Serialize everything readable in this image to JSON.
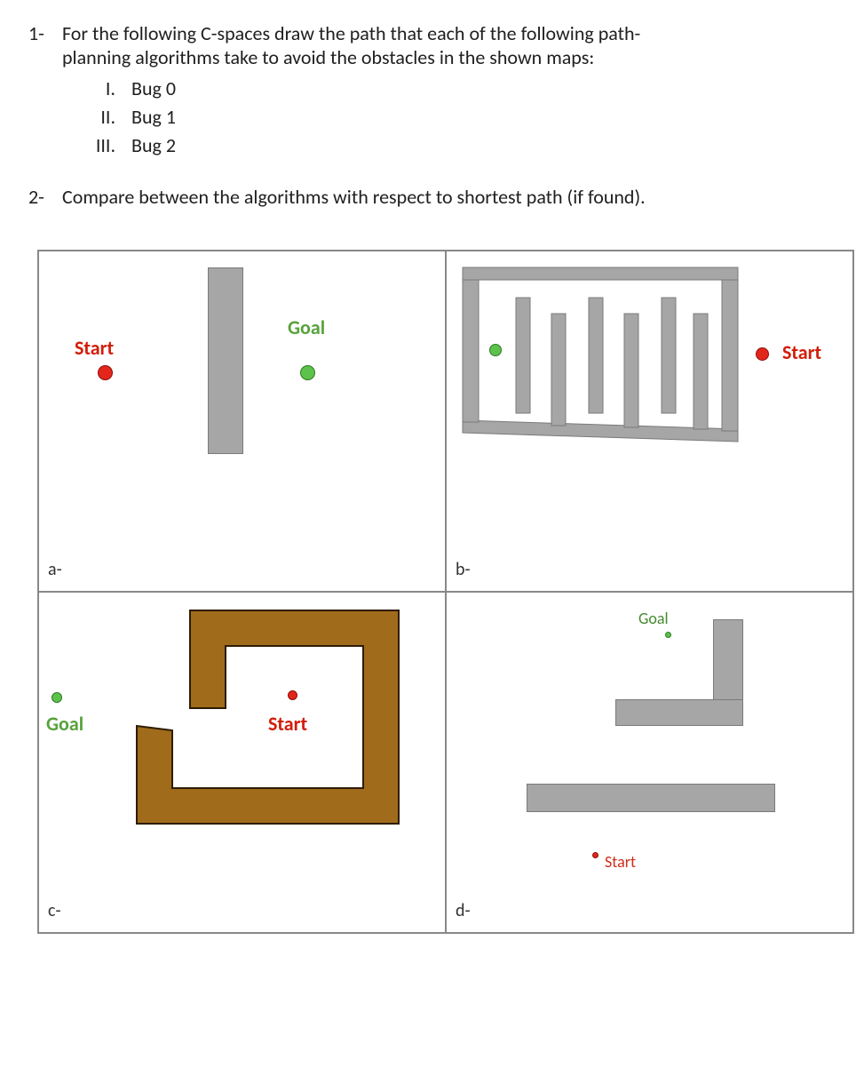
{
  "q1": {
    "num": "1-",
    "text_line1": "For the following C-spaces draw the path that each of the following path-",
    "text_line2": "planning algorithms take to avoid the obstacles in the shown maps:",
    "items": [
      {
        "roman": "I.",
        "label": "Bug 0"
      },
      {
        "roman": "II.",
        "label": "Bug 1"
      },
      {
        "roman": "III.",
        "label": "Bug 2"
      }
    ]
  },
  "q2": {
    "num": "2-",
    "text": "Compare between the algorithms with respect to shortest path (if found)."
  },
  "labels": {
    "start": "Start",
    "goal": "Goal"
  },
  "cells": {
    "a": "a-",
    "b": "b-",
    "c": "c-",
    "d": "d-"
  }
}
